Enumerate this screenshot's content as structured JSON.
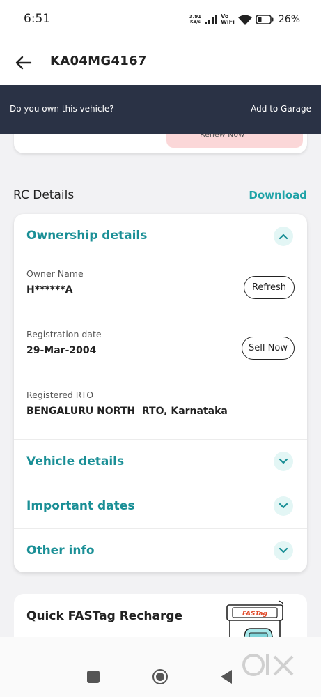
{
  "status_bar": {
    "time": "6:51",
    "net_speed_value": "3.91",
    "net_speed_unit": "KB/s",
    "volte_top": "Vo",
    "volte_bottom": "WiFi",
    "battery_percent": "26%"
  },
  "header": {
    "vehicle_number": "KA04MG4167"
  },
  "garage_banner": {
    "question": "Do you own this vehicle?",
    "action": "Add to Garage"
  },
  "previous_card": {
    "renew_label": "Renew Now"
  },
  "rc_section": {
    "title": "RC Details",
    "download_label": "Download"
  },
  "ownership": {
    "heading": "Ownership details",
    "owner_label": "Owner Name",
    "owner_value": "H******A",
    "refresh_label": "Refresh",
    "reg_date_label": "Registration date",
    "reg_date_value": "29-Mar-2004",
    "sell_label": "Sell Now",
    "rto_label": "Registered RTO",
    "rto_value": "BENGALURU NORTH  RTO, Karnataka"
  },
  "collapsed_sections": {
    "vehicle_details": "Vehicle details",
    "important_dates": "Important dates",
    "other_info": "Other info"
  },
  "fastag": {
    "title": "Quick FASTag Recharge",
    "logo_text": "FASTag"
  },
  "watermark": {
    "text": "OLX"
  },
  "colors": {
    "teal": "#1a8f96",
    "banner": "#2a3245",
    "renew_bg": "#fbd7d8"
  }
}
